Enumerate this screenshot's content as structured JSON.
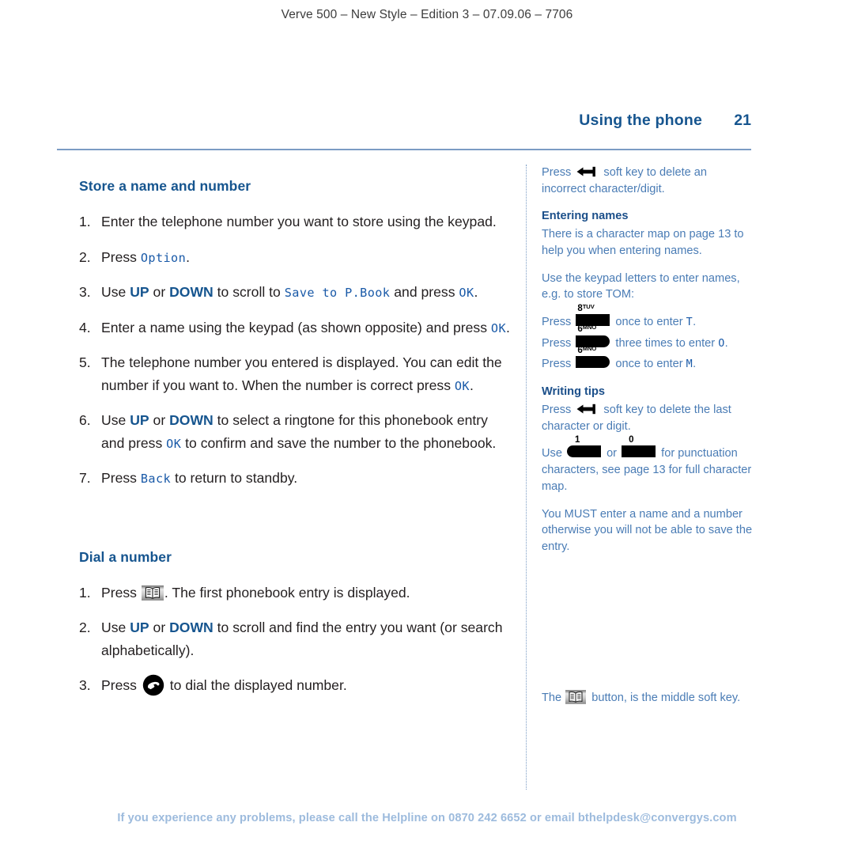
{
  "running_head": "Verve 500 – New Style – Edition 3 – 07.09.06 – 7706",
  "header": {
    "chapter": "Using the phone",
    "page_number": "21"
  },
  "main": {
    "sections": [
      {
        "title": "Store a name and number",
        "steps": [
          {
            "num": "1.",
            "text": "Enter the telephone number you want to store using the keypad."
          },
          {
            "num": "2.",
            "text_a": "Press ",
            "lcd_1": "Option",
            "text_b": "."
          },
          {
            "num": "3.",
            "text_a": "Use ",
            "key_1": "UP",
            "text_b": " or ",
            "key_2": "DOWN",
            "text_c": " to scroll to ",
            "lcd_1": "Save to P.Book",
            "text_d": " and press ",
            "lcd_2": "OK",
            "text_e": "."
          },
          {
            "num": "4.",
            "text_a": "Enter a name using the keypad (as shown opposite) and press ",
            "lcd_1": "OK",
            "text_b": "."
          },
          {
            "num": "5.",
            "text_a": "The telephone number you entered is displayed. You can edit the number if you want to. When the number is correct press ",
            "lcd_1": "OK",
            "text_b": "."
          },
          {
            "num": "6.",
            "text_a": "Use ",
            "key_1": "UP",
            "text_b": " or ",
            "key_2": "DOWN",
            "text_c": " to select a ringtone for this phonebook entry and press ",
            "lcd_1": "OK",
            "text_d": " to confirm and save the number to the phonebook."
          },
          {
            "num": "7.",
            "text_a": "Press ",
            "lcd_1": "Back",
            "text_b": " to return to standby."
          }
        ]
      },
      {
        "title": "Dial a number",
        "steps": [
          {
            "num": "1.",
            "text_a": "Press ",
            "icon": "phonebook-book-icon",
            "text_b": ". The first phonebook entry is displayed."
          },
          {
            "num": "2.",
            "text_a": "Use ",
            "key_1": "UP",
            "text_b": " or ",
            "key_2": "DOWN",
            "text_c": " to scroll and find the entry you want (or search alphabetically)."
          },
          {
            "num": "3.",
            "text_a": "Press ",
            "icon": "phone-handset-icon",
            "text_b": " to dial the displayed number."
          }
        ]
      }
    ]
  },
  "sidebar": {
    "delete_note": {
      "text_a": "Press ",
      "icon": "backspace-arrow-icon",
      "text_b": " soft key to delete an incorrect character/digit."
    },
    "entering_names": {
      "heading": "Entering names",
      "body": "There is a character map on page 13 to help you when entering names.",
      "intro": "Use the keypad letters to enter names, e.g. to store TOM:",
      "presses": [
        {
          "text_a": "Press ",
          "key_digit": "8",
          "key_letters": "TUV",
          "key_shape": "square",
          "text_b": " once to enter ",
          "lcd": "T",
          "text_c": "."
        },
        {
          "text_a": "Press ",
          "key_digit": "6",
          "key_letters": "MNO",
          "key_shape": "round-right",
          "text_b": " three times to enter ",
          "lcd": "O",
          "text_c": "."
        },
        {
          "text_a": "Press ",
          "key_digit": "6",
          "key_letters": "MNO",
          "key_shape": "round-right",
          "text_b": " once to enter ",
          "lcd": "M",
          "text_c": "."
        }
      ]
    },
    "writing_tips": {
      "heading": "Writing tips",
      "delete_text_a": "Press ",
      "delete_icon": "backspace-arrow-icon",
      "delete_text_b": " soft key to delete the last character or digit.",
      "punct_text_a": "Use ",
      "punct_key_1_digit": "1",
      "punct_key_1_shape": "round-left",
      "punct_text_b": " or ",
      "punct_key_2_digit": "0",
      "punct_key_2_shape": "square",
      "punct_text_c": " for punctuation characters, see page 13 for full character map."
    },
    "must_note": "You MUST enter a name and a number otherwise you will not be able to save the entry.",
    "soft_key_note": {
      "text_a": "The ",
      "icon": "phonebook-book-icon",
      "text_b": " button, is the middle soft key."
    }
  },
  "footer": "If you experience any problems, please call the Helpline on 0870 242 6652 or email bthelpdesk@convergys.com",
  "colors": {
    "heading_blue": "#16558f",
    "lcd_blue": "#1a5aa8",
    "sidebar_blue": "#4a7cb5",
    "rule_blue": "#7b9cc4",
    "footer_blue": "#9dbbdd",
    "body_text": "#231f20"
  }
}
